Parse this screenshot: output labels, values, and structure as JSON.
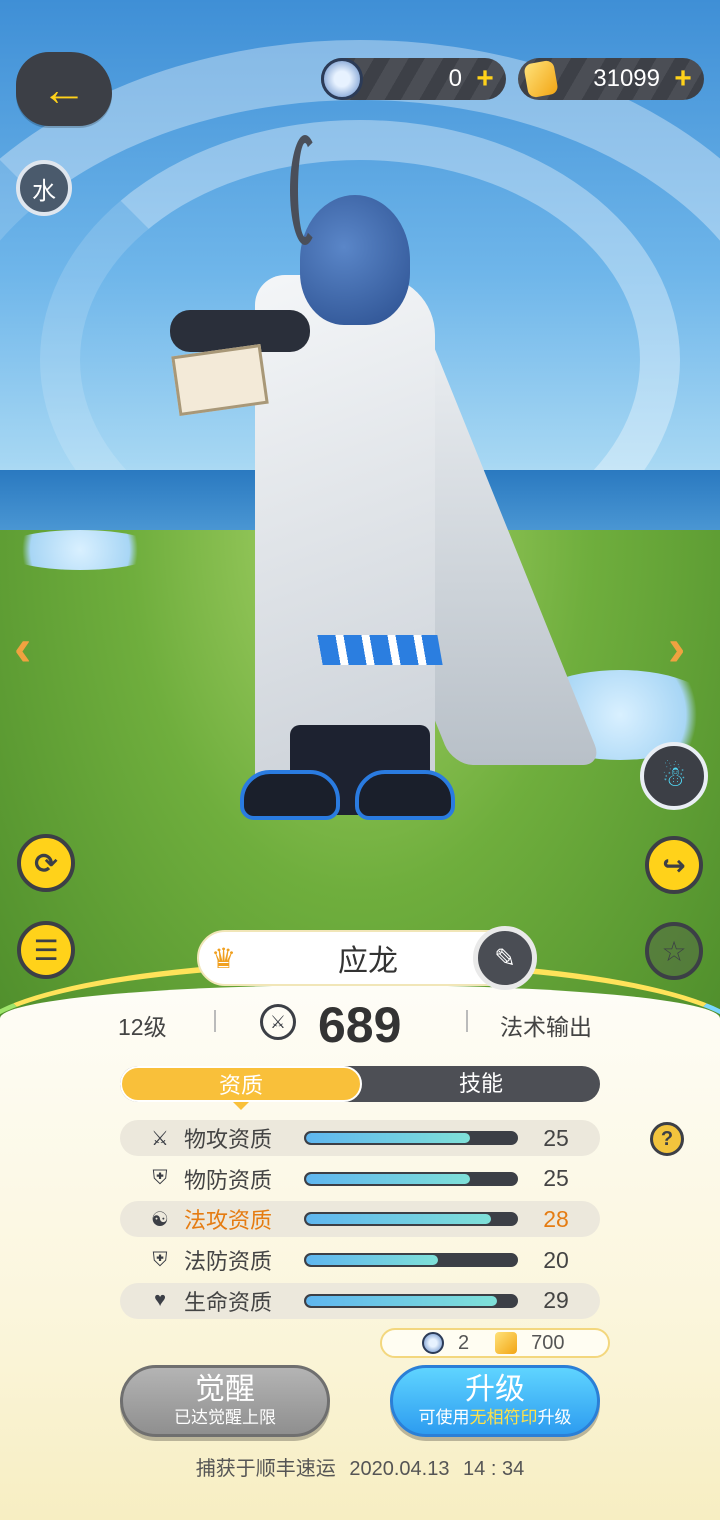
{
  "currency": {
    "gems": "0",
    "gold": "31099",
    "plus_symbol": "+"
  },
  "element_badge": "水",
  "pet": {
    "name": "应龙",
    "level": "12级",
    "power": "689",
    "role": "法术输出"
  },
  "tabs": [
    {
      "label": "资质",
      "active": true
    },
    {
      "label": "技能",
      "active": false
    }
  ],
  "stats": [
    {
      "icon": "swords-icon",
      "label": "物攻资质",
      "value": "25",
      "fill_fraction": 0.78
    },
    {
      "icon": "shield-icon",
      "label": "物防资质",
      "value": "25",
      "fill_fraction": 0.78
    },
    {
      "icon": "magic-swirl-icon",
      "label": "法攻资质",
      "value": "28",
      "fill_fraction": 0.88,
      "highlight": true
    },
    {
      "icon": "magic-shield-icon",
      "label": "法防资质",
      "value": "20",
      "fill_fraction": 0.63
    },
    {
      "icon": "heart-icon",
      "label": "生命资质",
      "value": "29",
      "fill_fraction": 0.91
    }
  ],
  "upgrade_cost": {
    "gems": "2",
    "gold": "700"
  },
  "buttons": {
    "awaken_main": "觉醒",
    "awaken_sub": "已达觉醒上限",
    "upgrade_main": "升级",
    "upgrade_sub_prefix": "可使用",
    "upgrade_sub_accent": "无相符印",
    "upgrade_sub_suffix": "升级"
  },
  "caught_info": {
    "prefix": "捕获于顺丰速运",
    "date": "2020.04.13",
    "time": "14 : 34"
  },
  "colors": {
    "accent_yellow": "#ffd21a",
    "highlight_orange": "#e57c12",
    "bar_fill": "#5fb6ef",
    "dark_ui": "#3c3f46"
  }
}
